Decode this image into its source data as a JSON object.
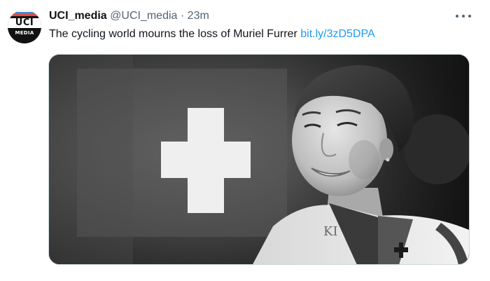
{
  "tweet": {
    "author": {
      "display_name": "UCI_media",
      "handle": "@UCI_media",
      "separator": "·",
      "time": "23m",
      "avatar_logo_text": "UCI",
      "avatar_sub_text": "MEDIA"
    },
    "text_prefix": "The cycling world mourns the loss of Muriel Furrer ",
    "link_text": "bit.ly/3zD5DPA",
    "more_icon": "more-horizontal-icon",
    "media": {
      "type": "photo",
      "style": "black-and-white",
      "jersey_lettering": "KI"
    }
  },
  "colors": {
    "text": "#0f1419",
    "secondary": "#536471",
    "link": "#1d9bf0",
    "uci_stripes": [
      "#3c8ed6",
      "#e84a3d",
      "#111111",
      "#f5c518",
      "#3aa655"
    ]
  }
}
